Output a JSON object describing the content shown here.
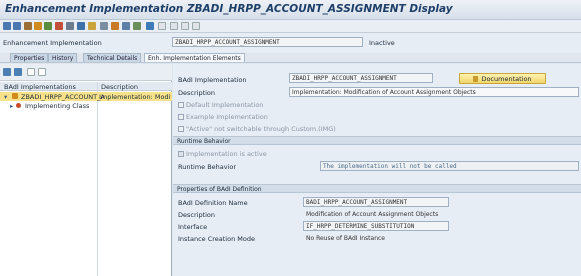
{
  "window": {
    "title": "Enhancement Implementation ZBADI_HRPP_ACCOUNT_ASSIGNMENT Display"
  },
  "header": {
    "impl_label": "Enhancement Implementation",
    "impl_value": "ZBADI_HRPP_ACCOUNT_ASSIGNMENT",
    "status": "Inactive"
  },
  "tabs": [
    "Properties",
    "History",
    "Technical Details",
    "Enh. Implementation Elements"
  ],
  "tree": {
    "col1": "BAdI Implementations",
    "col2": "Description",
    "root_label": "ZBADI_HRPP_ACCOUNT_A",
    "root_desc": "Implementation: Modifica",
    "child_label": "Implementing Class"
  },
  "details": {
    "badi_impl_label": "BAdI Implementation",
    "badi_impl_value": "ZBADI_HRPP_ACCOUNT_ASSIGNMENT",
    "doc_button": "Documentation",
    "desc_label": "Description",
    "desc_value": "Implementation: Modification of Account Assignment Objects",
    "default_impl": "Default Implementation",
    "example_impl": "Example Implementation",
    "active_not_switchable": "\"Active\" not switchable through Custom.(IMG)"
  },
  "runtime": {
    "section_title": "Runtime Behavior",
    "active_label": "Implementation is active",
    "behavior_label": "Runtime Behavior",
    "behavior_value": "The implementation will not be called"
  },
  "badi_def": {
    "section_title": "Properties of BAdI Definition",
    "name_label": "BAdI Definition Name",
    "name_value": "BADI_HRPP_ACCOUNT_ASSIGNMENT",
    "desc_label": "Description",
    "desc_value": "Modification of Account Assignment Objects",
    "iface_label": "Interface",
    "iface_value": "IF_HRPP_DETERMINE_SUBSTITUTION",
    "mode_label": "Instance Creation Mode",
    "mode_value": "No Reuse of BAdI Instance"
  },
  "icons": [
    "back-icon",
    "forward-icon",
    "tool-icon",
    "activate-icon",
    "where-used-icon",
    "object-list-icon",
    "display-change-icon",
    "create-icon",
    "copy-icon",
    "help-icon"
  ]
}
